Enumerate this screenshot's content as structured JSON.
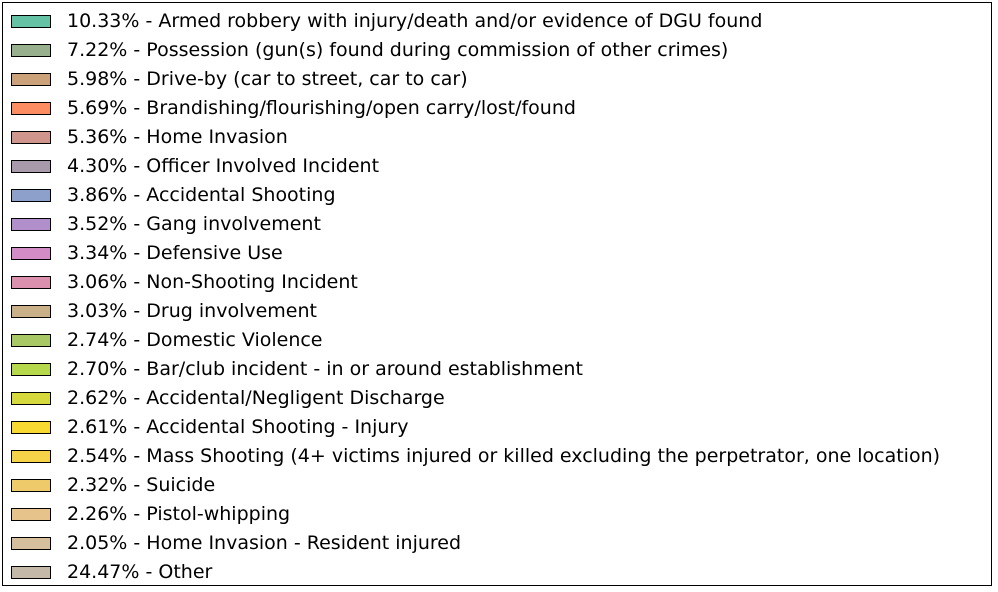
{
  "chart_data": {
    "type": "pie",
    "legend_placement": "full-figure",
    "slices": [
      {
        "percent": "10.33%",
        "label": "Armed robbery with injury/death and/or evidence of DGU found",
        "color": "#66c2a5"
      },
      {
        "percent": "7.22%",
        "label": "Possession (gun(s) found during commission of other crimes)",
        "color": "#99b08f"
      },
      {
        "percent": "5.98%",
        "label": "Drive-by (car to street, car to car)",
        "color": "#cca27a"
      },
      {
        "percent": "5.69%",
        "label": "Brandishing/flourishing/open carry/lost/found",
        "color": "#fc8d62"
      },
      {
        "percent": "5.36%",
        "label": "Home Invasion",
        "color": "#d0958c"
      },
      {
        "percent": "4.30%",
        "label": "Officer Involved Incident",
        "color": "#a99aab"
      },
      {
        "percent": "3.86%",
        "label": "Accidental Shooting",
        "color": "#8da0cb"
      },
      {
        "percent": "3.52%",
        "label": "Gang involvement",
        "color": "#b18fca"
      },
      {
        "percent": "3.34%",
        "label": "Defensive Use",
        "color": "#d48cc7"
      },
      {
        "percent": "3.06%",
        "label": "Non-Shooting Incident",
        "color": "#db90ae"
      },
      {
        "percent": "3.03%",
        "label": "Drug involvement",
        "color": "#c9b089"
      },
      {
        "percent": "2.74%",
        "label": "Domestic Violence",
        "color": "#a8c865"
      },
      {
        "percent": "2.70%",
        "label": "Bar/club incident - in or around establishment",
        "color": "#b5d84c"
      },
      {
        "percent": "2.62%",
        "label": "Accidental/Negligent Discharge",
        "color": "#d6d93e"
      },
      {
        "percent": "2.61%",
        "label": "Accidental Shooting - Injury",
        "color": "#f8d931"
      },
      {
        "percent": "2.54%",
        "label": "Mass Shooting (4+ victims injured or killed excluding the perpetrator, one location)",
        "color": "#f6d248"
      },
      {
        "percent": "2.32%",
        "label": "Suicide",
        "color": "#eeca6a"
      },
      {
        "percent": "2.26%",
        "label": "Pistol-whipping",
        "color": "#e6c38a"
      },
      {
        "percent": "2.05%",
        "label": "Home Invasion - Resident injured",
        "color": "#d6bf9c"
      },
      {
        "percent": "24.47%",
        "label": "Other",
        "color": "#c4b9a8"
      }
    ]
  }
}
